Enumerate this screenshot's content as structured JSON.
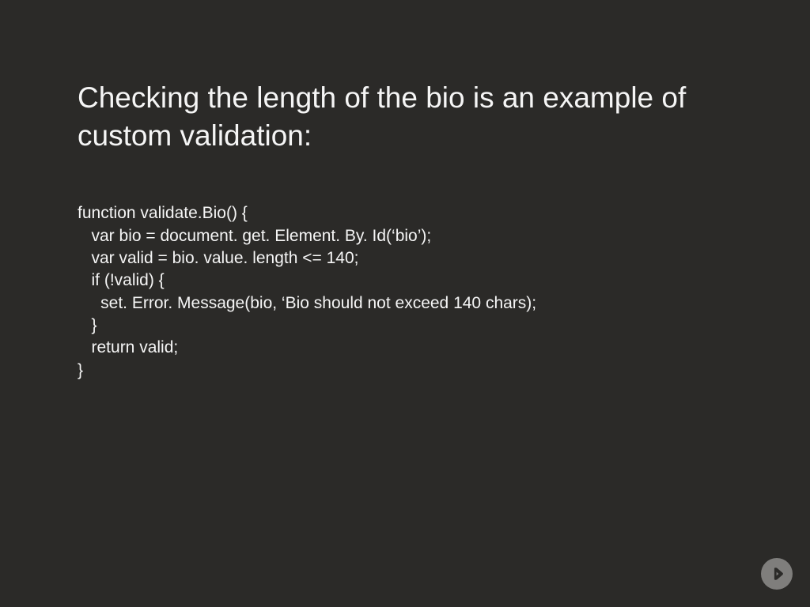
{
  "heading": "Checking the length of the bio is an example of custom validation:",
  "code": {
    "l1": "function validate.Bio() {",
    "l2": "   var bio = document. get. Element. By. Id(‘bio’);",
    "l3": "   var valid = bio. value. length <= 140;",
    "l4": "   if (!valid) {",
    "l5": "     set. Error. Message(bio, ‘Bio should not exceed 140 chars);",
    "l6": "   }",
    "l7": "   return valid;",
    "l8": "}"
  }
}
